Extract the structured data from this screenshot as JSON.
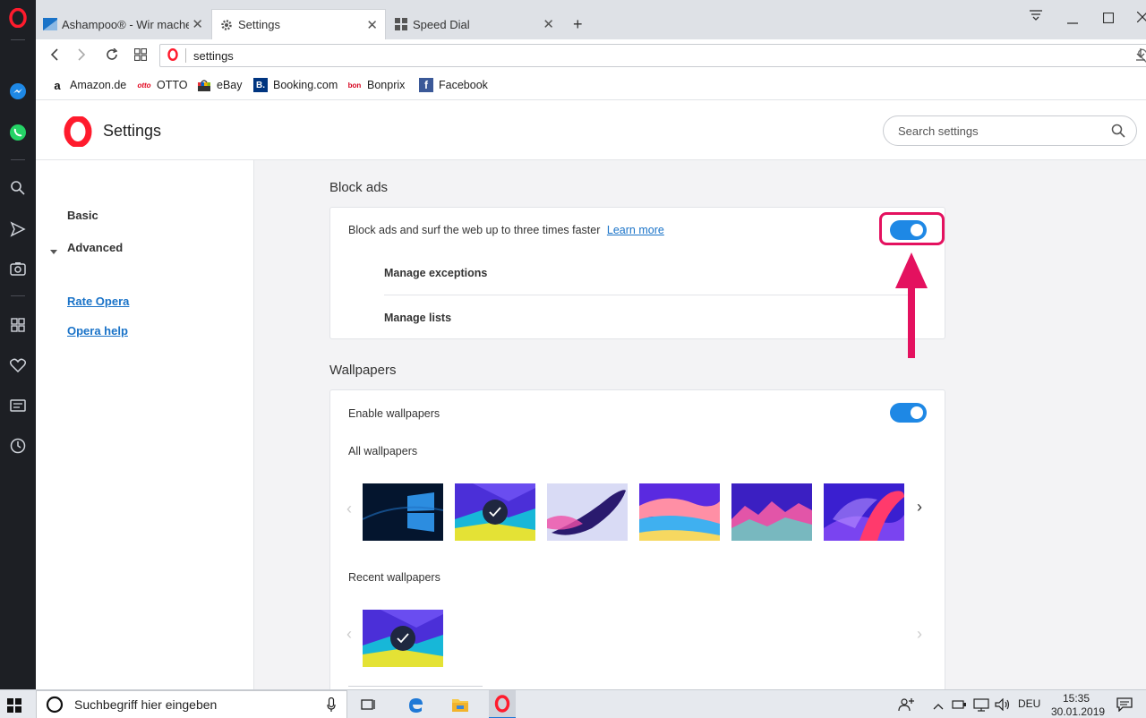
{
  "browser": {
    "tabs": [
      {
        "title": "Ashampoo® - Wir machen",
        "favicon": "ashampoo-icon"
      },
      {
        "title": "Settings",
        "favicon": "gear-icon",
        "active": true
      },
      {
        "title": "Speed Dial",
        "favicon": "speed-dial-icon"
      }
    ],
    "new_tab_label": "+",
    "url": "settings",
    "bookmarks": [
      {
        "label": "Amazon.de",
        "icon": "amazon-icon"
      },
      {
        "label": "OTTO",
        "icon": "otto-icon"
      },
      {
        "label": "eBay",
        "icon": "ebay-icon"
      },
      {
        "label": "Booking.com",
        "icon": "booking-icon"
      },
      {
        "label": "Bonprix",
        "icon": "bonprix-icon"
      },
      {
        "label": "Facebook",
        "icon": "facebook-icon"
      }
    ]
  },
  "settings": {
    "title": "Settings",
    "search_placeholder": "Search settings",
    "nav": {
      "basic": "Basic",
      "advanced": "Advanced",
      "rate_opera": "Rate Opera",
      "opera_help": "Opera help"
    },
    "block_ads": {
      "section_title": "Block ads",
      "description": "Block ads and surf the web up to three times faster",
      "learn_more": "Learn more",
      "enabled": true,
      "manage_exceptions": "Manage exceptions",
      "manage_lists": "Manage lists"
    },
    "wallpapers": {
      "section_title": "Wallpapers",
      "enable_label": "Enable wallpapers",
      "enabled": true,
      "all_label": "All wallpapers",
      "recent_label": "Recent wallpapers",
      "selected_index": 1
    }
  },
  "taskbar": {
    "search_text": "Suchbegriff hier eingeben",
    "language": "DEU",
    "time": "15:35",
    "date": "30.01.2019"
  },
  "colors": {
    "accent": "#1e88e5",
    "highlight": "#e4115f",
    "opera_red": "#ff1b2d"
  }
}
